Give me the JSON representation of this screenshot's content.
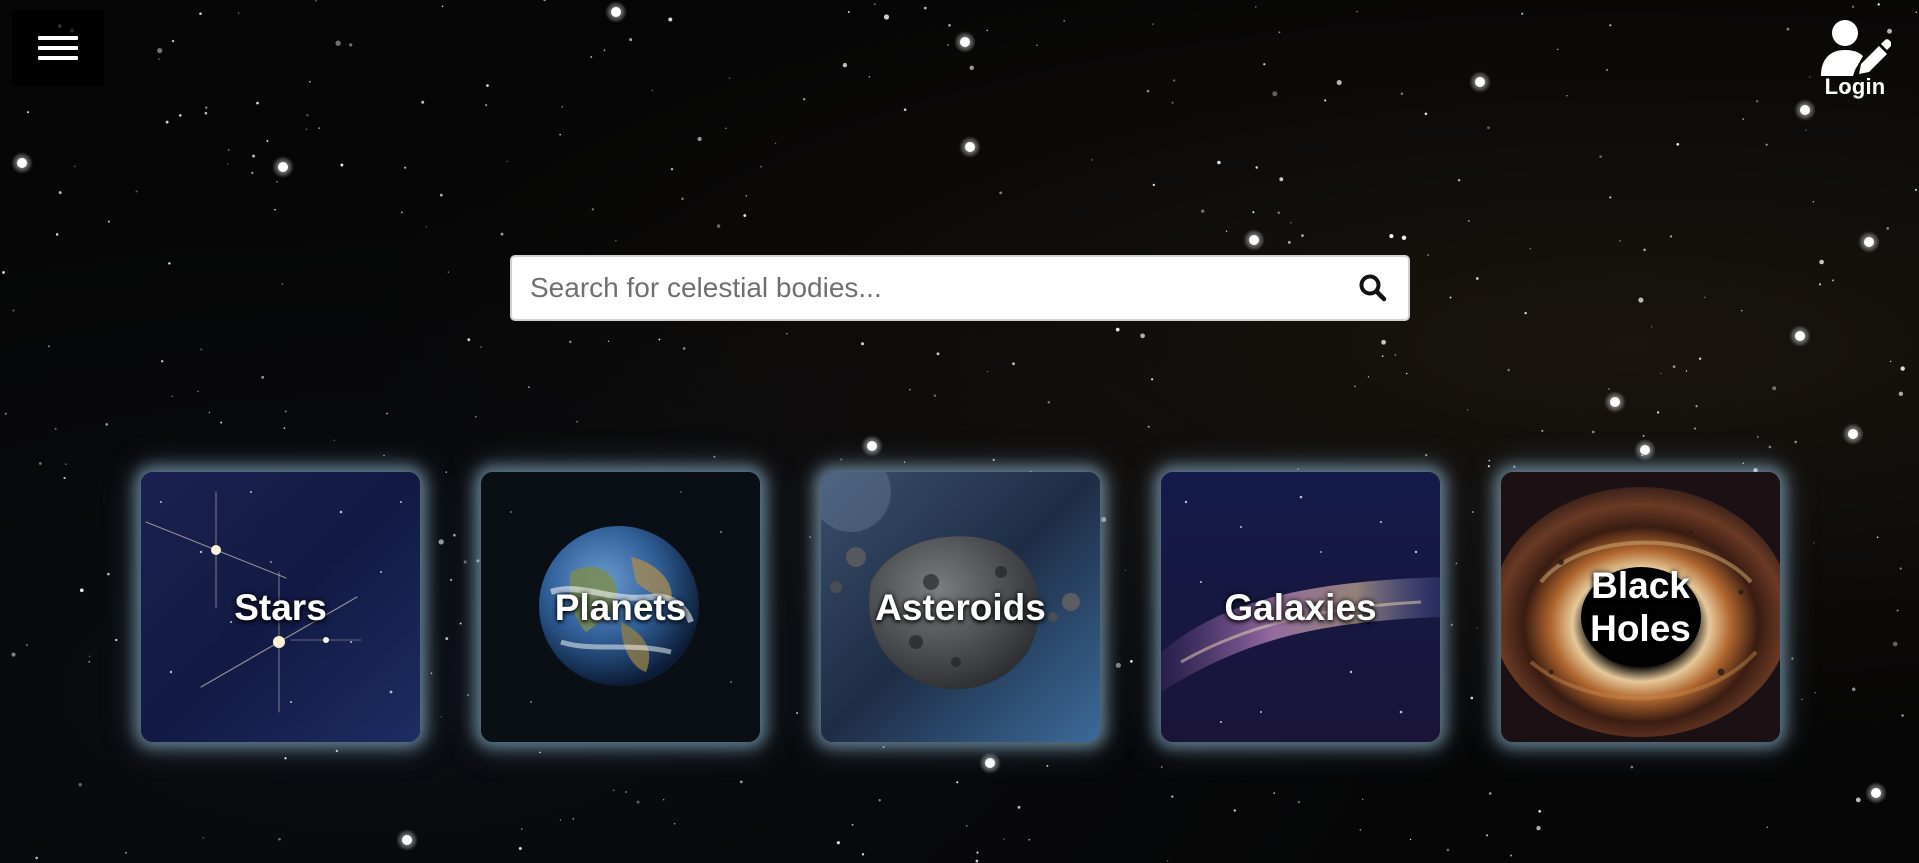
{
  "header": {
    "menu_icon": "hamburger-menu-icon",
    "login_icon": "user-edit-icon",
    "login_label": "Login"
  },
  "search": {
    "placeholder": "Search for celestial bodies...",
    "value": "",
    "icon": "search-icon"
  },
  "categories": [
    {
      "label": "Stars",
      "icon": "stars-image"
    },
    {
      "label": "Planets",
      "icon": "planet-earth-image"
    },
    {
      "label": "Asteroids",
      "icon": "asteroid-image"
    },
    {
      "label": "Galaxies",
      "icon": "galaxy-image"
    },
    {
      "label": "Black Holes",
      "icon": "black-hole-image"
    }
  ],
  "colors": {
    "background": "#060606",
    "text": "#ffffff",
    "card_glow": "#96bed7"
  }
}
